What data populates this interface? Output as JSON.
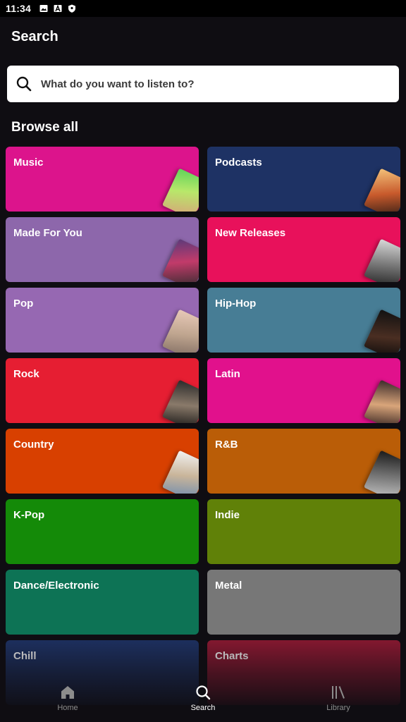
{
  "status_bar": {
    "time": "11:34"
  },
  "header": {
    "title": "Search"
  },
  "search": {
    "placeholder": "What do you want to listen to?"
  },
  "browse": {
    "heading": "Browse all"
  },
  "tiles": [
    {
      "label": "Music",
      "color": "#dc148c"
    },
    {
      "label": "Podcasts",
      "color": "#1e3264"
    },
    {
      "label": "Made For You",
      "color": "#8d67ab"
    },
    {
      "label": "New Releases",
      "color": "#e8115b"
    },
    {
      "label": "Pop",
      "color": "#9668b2"
    },
    {
      "label": "Hip-Hop",
      "color": "#477d95"
    },
    {
      "label": "Rock",
      "color": "#e61e32"
    },
    {
      "label": "Latin",
      "color": "#e1118c"
    },
    {
      "label": "Country",
      "color": "#d84000"
    },
    {
      "label": "R&B",
      "color": "#ba5d07"
    },
    {
      "label": "K-Pop",
      "color": "#148a08"
    },
    {
      "label": "Indie",
      "color": "#608108"
    },
    {
      "label": "Dance/Electronic",
      "color": "#0d7355"
    },
    {
      "label": "Metal",
      "color": "#777777"
    },
    {
      "label": "Chill",
      "color": "#1e3264"
    },
    {
      "label": "Charts",
      "color": "#8d1932"
    }
  ],
  "bottom_nav": [
    {
      "label": "Home",
      "icon": "home-icon",
      "active": false
    },
    {
      "label": "Search",
      "icon": "search-icon",
      "active": true
    },
    {
      "label": "Library",
      "icon": "library-icon",
      "active": false
    }
  ]
}
